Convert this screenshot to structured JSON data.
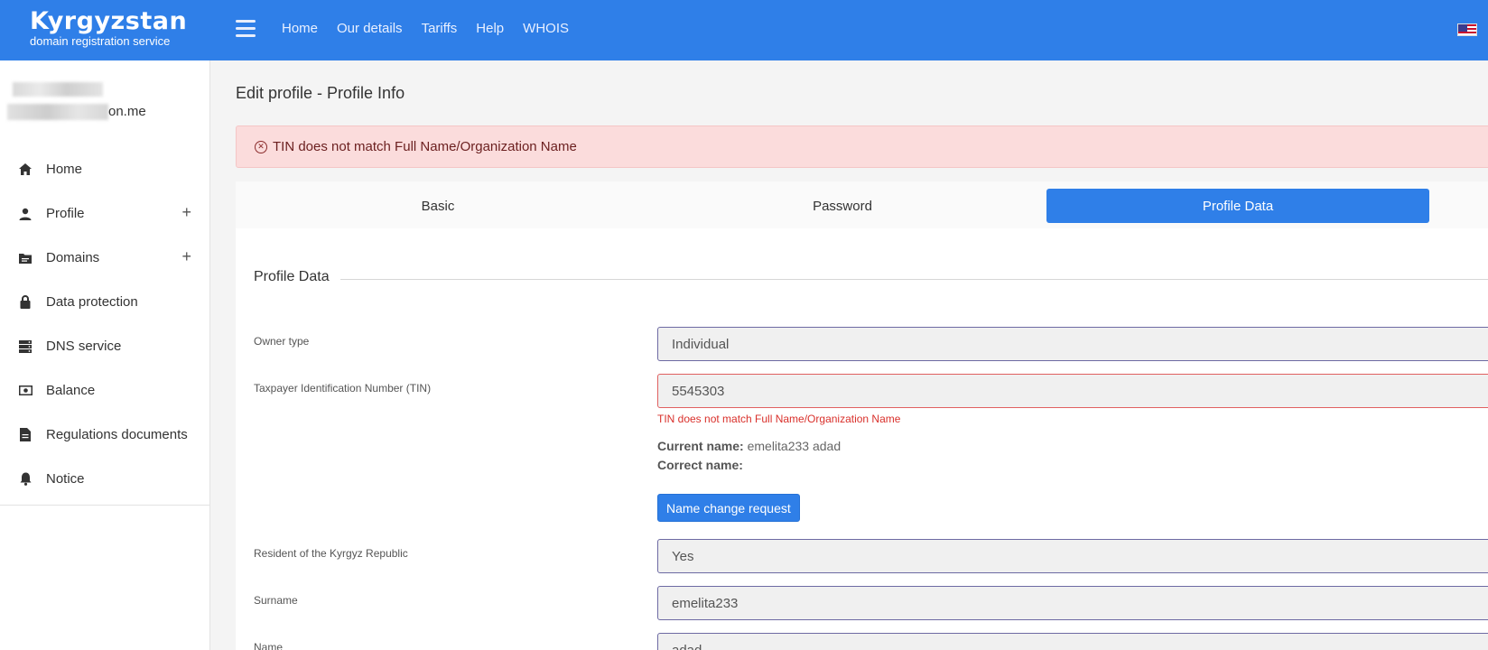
{
  "header": {
    "logo_title": "Kyrgyzstan",
    "logo_subtitle": "domain registration service",
    "nav": [
      "Home",
      "Our details",
      "Tariffs",
      "Help",
      "WHOIS"
    ],
    "accent": "#2f7fe8"
  },
  "sidebar": {
    "user_email_suffix": "on.me",
    "items": [
      {
        "label": "Home",
        "icon": "home-icon"
      },
      {
        "label": "Profile",
        "icon": "person-icon",
        "expand": "+"
      },
      {
        "label": "Domains",
        "icon": "folder-icon",
        "expand": "+"
      },
      {
        "label": "Data protection",
        "icon": "lock-icon"
      },
      {
        "label": "DNS service",
        "icon": "server-icon"
      },
      {
        "label": "Balance",
        "icon": "money-icon"
      },
      {
        "label": "Regulations documents",
        "icon": "document-icon"
      },
      {
        "label": "Notice",
        "icon": "bell-icon"
      }
    ]
  },
  "main": {
    "title": "Edit profile - Profile Info",
    "alert": "TIN does not match Full Name/Organization Name",
    "tabs": [
      {
        "label": "Basic",
        "active": false
      },
      {
        "label": "Password",
        "active": false
      },
      {
        "label": "Profile Data",
        "active": true
      }
    ],
    "section_title": "Profile Data",
    "fields": {
      "owner_type": {
        "label": "Owner type",
        "value": "Individual"
      },
      "tin": {
        "label": "Taxpayer Identification Number (TIN)",
        "value": "5545303",
        "error": "TIN does not match Full Name/Organization Name"
      },
      "resident": {
        "label": "Resident of the Kyrgyz Republic",
        "value": "Yes"
      },
      "surname": {
        "label": "Surname",
        "value": "emelita233"
      },
      "name": {
        "label": "Name",
        "value": "adad"
      }
    },
    "current_name_label": "Current name:",
    "current_name_value": "emelita233 adad",
    "correct_name_label": "Correct name:",
    "name_change_button": "Name change request"
  }
}
